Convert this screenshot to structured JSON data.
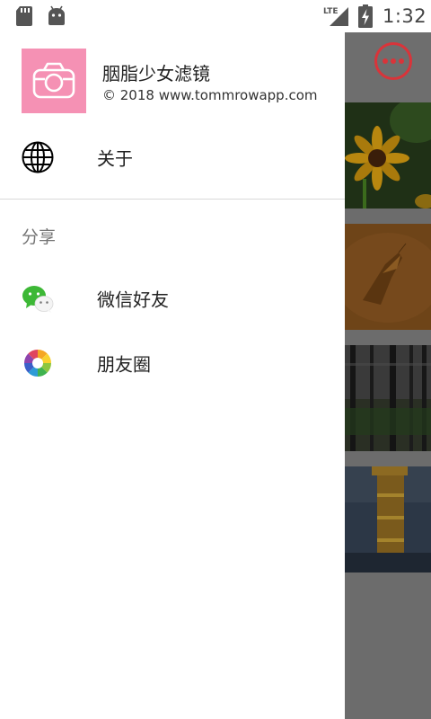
{
  "status_bar": {
    "network": "LTE",
    "time": "1:32"
  },
  "drawer": {
    "header": {
      "app_name": "胭脂少女滤镜",
      "copyright": "© 2018 www.tommrowapp.com"
    },
    "about": {
      "label": "关于",
      "icon": "globe-icon"
    },
    "share_section": {
      "title": "分享",
      "items": [
        {
          "label": "微信好友",
          "icon": "wechat-icon"
        },
        {
          "label": "朋友圈",
          "icon": "moments-icon"
        }
      ]
    }
  },
  "colors": {
    "logo_pink": "#f591b4",
    "accent_red": "#d9343a",
    "wechat_green": "#3db836"
  },
  "background_app": {
    "more_button_icon": "more-horizontal-icon",
    "thumbnails": [
      "flower-photo",
      "moth-photo",
      "forest-photo",
      "pagoda-photo"
    ]
  }
}
